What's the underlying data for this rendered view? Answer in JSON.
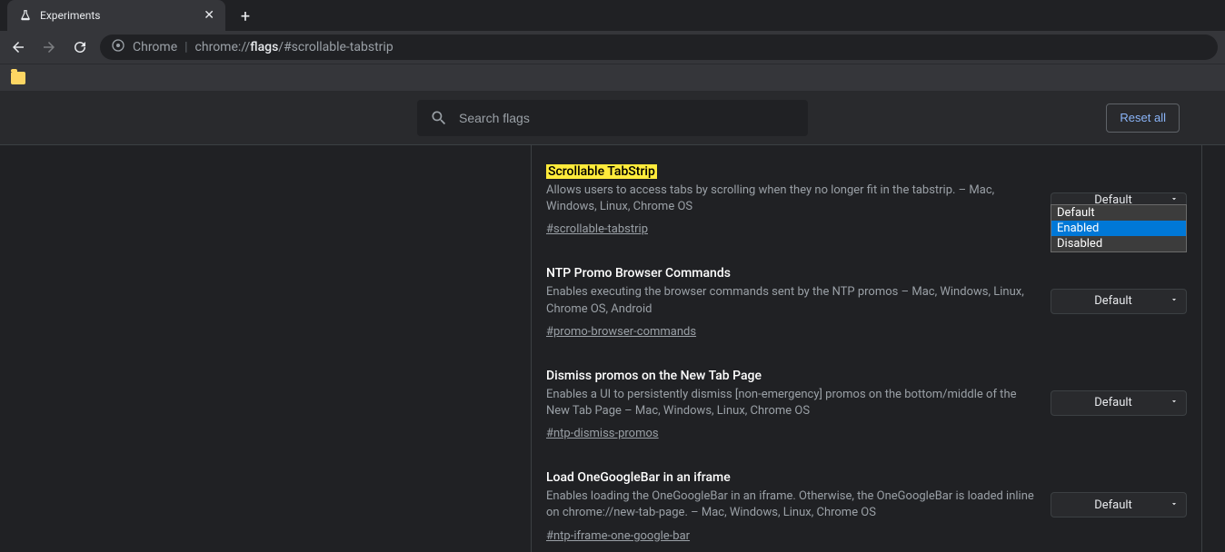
{
  "tab": {
    "title": "Experiments"
  },
  "url": {
    "prefix": "Chrome",
    "scheme": "chrome://",
    "bold": "flags",
    "rest": "/#scrollable-tabstrip"
  },
  "search": {
    "placeholder": "Search flags"
  },
  "buttons": {
    "reset_all": "Reset all"
  },
  "dropdown_options": [
    "Default",
    "Enabled",
    "Disabled"
  ],
  "flags": [
    {
      "title": "Scrollable TabStrip",
      "desc": "Allows users to access tabs by scrolling when they no longer fit in the tabstrip. – Mac, Windows, Linux, Chrome OS",
      "hash": "#scrollable-tabstrip",
      "value": "Default",
      "highlighted": true,
      "open": true
    },
    {
      "title": "NTP Promo Browser Commands",
      "desc": "Enables executing the browser commands sent by the NTP promos – Mac, Windows, Linux, Chrome OS, Android",
      "hash": "#promo-browser-commands",
      "value": "Default"
    },
    {
      "title": "Dismiss promos on the New Tab Page",
      "desc": "Enables a UI to persistently dismiss [non-emergency] promos on the bottom/middle of the New Tab Page – Mac, Windows, Linux, Chrome OS",
      "hash": "#ntp-dismiss-promos",
      "value": "Default"
    },
    {
      "title": "Load OneGoogleBar in an iframe",
      "desc": "Enables loading the OneGoogleBar in an iframe. Otherwise, the OneGoogleBar is loaded inline on chrome://new-tab-page. – Mac, Windows, Linux, Chrome OS",
      "hash": "#ntp-iframe-one-google-bar",
      "value": "Default"
    }
  ]
}
